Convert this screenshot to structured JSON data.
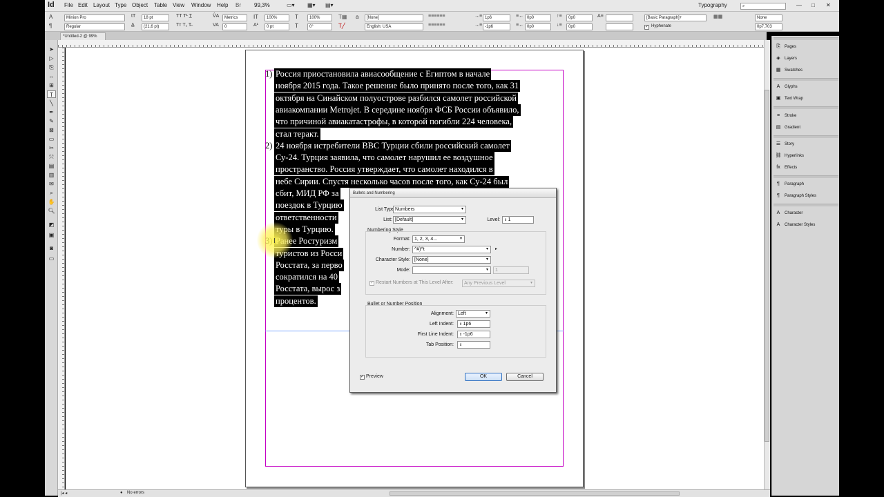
{
  "app": {
    "logo": "Id",
    "menus": [
      "File",
      "Edit",
      "Layout",
      "Type",
      "Object",
      "Table",
      "View",
      "Window",
      "Help"
    ],
    "zoom": "99,3%",
    "workspace": "Typography",
    "search_placeholder": ""
  },
  "control": {
    "font_family": "Minion Pro",
    "font_style": "Regular",
    "font_size": "18 pt",
    "leading": "(21,6 pt)",
    "kerning": "Metrics",
    "tracking": "0",
    "vscale": "100%",
    "hscale": "100%",
    "baseline": "0 pt",
    "skew": "0°",
    "char_style": "[None]",
    "language": "English: USA",
    "left_indent": "1p6",
    "first_line": "-1p6",
    "right_indent": "0p0",
    "last_line": "0p0",
    "space_before": "0p0",
    "space_after": "0p0",
    "para_style": "[Basic Paragraph]+",
    "hyphenate_label": "Hyphenate",
    "cols_value": "None",
    "baseline_value": "0p7,703"
  },
  "document": {
    "tab_label": "*Untitled-2 @ 99%"
  },
  "text": {
    "lines": [
      {
        "num": "1)",
        "text": "Россия приостановила авиасообщение с Египтом в начале"
      },
      {
        "num": "",
        "text": "ноября 2015 года. Такое решение было принято после того, как 31"
      },
      {
        "num": "",
        "text": "октября на Синайском полуострове разбился самолет российской"
      },
      {
        "num": "",
        "text": "авиакомпании Metrojet. В середине ноября ФСБ России объявило,"
      },
      {
        "num": "",
        "text": "что причиной авиакатастрофы, в которой погибли 224 человека,"
      },
      {
        "num": "",
        "text": "стал теракт."
      },
      {
        "num": "2)",
        "text": "24 ноября истребители ВВС Турции сбили российский самолет"
      },
      {
        "num": "",
        "text": "Су-24. Турция заявила, что самолет нарушил ее воздушное"
      },
      {
        "num": "",
        "text": "пространство. Россия утверждает, что самолет находился в"
      },
      {
        "num": "",
        "text": "небе Сирии. Спустя несколько часов после того, как Су-24 был"
      },
      {
        "num": "",
        "text": "сбит, МИД РФ за"
      },
      {
        "num": "",
        "text": "поездок в Турцию"
      },
      {
        "num": "",
        "text": "ответственности"
      },
      {
        "num": "",
        "text": "туры в Турцию."
      },
      {
        "num": "3)",
        "text": "Ранее Ростуризм"
      },
      {
        "num": "",
        "text": "туристов из Росси"
      },
      {
        "num": "",
        "text": "Росстата, за перво"
      },
      {
        "num": "",
        "text": "сократился на 40"
      },
      {
        "num": "",
        "text": "Росстата, вырос з"
      },
      {
        "num": "",
        "text": "процентов."
      }
    ]
  },
  "dialog": {
    "title": "Bullets and Numbering",
    "list_type_label": "List Type:",
    "list_type_value": "Numbers",
    "list_label": "List:",
    "list_value": "[Default]",
    "level_label": "Level:",
    "level_value": "1",
    "numbering_style_heading": "Numbering Style",
    "format_label": "Format:",
    "format_value": "1, 2, 3, 4...",
    "number_label": "Number:",
    "number_value": "^#)^t",
    "char_style_label": "Character Style:",
    "char_style_value": "[None]",
    "mode_label": "Mode:",
    "mode_value": "",
    "mode_num": "1",
    "restart_label": "Restart Numbers at This Level After:",
    "restart_value": "Any Previous Level",
    "position_heading": "Bullet or Number Position",
    "alignment_label": "Alignment:",
    "alignment_value": "Left",
    "left_indent_label": "Left Indent:",
    "left_indent_value": "1p6",
    "first_line_label": "First Line Indent:",
    "first_line_value": "-1p6",
    "tab_position_label": "Tab Position:",
    "tab_position_value": "",
    "preview_label": "Preview",
    "ok_label": "OK",
    "cancel_label": "Cancel"
  },
  "panels": {
    "items": [
      "Pages",
      "Layers",
      "Swatches",
      "Glyphs",
      "Text Wrap",
      "Stroke",
      "Gradient",
      "Story",
      "Hyperlinks",
      "Effects",
      "Paragraph",
      "Paragraph Styles",
      "Character",
      "Character Styles"
    ]
  },
  "status": {
    "errors": "No errors"
  }
}
